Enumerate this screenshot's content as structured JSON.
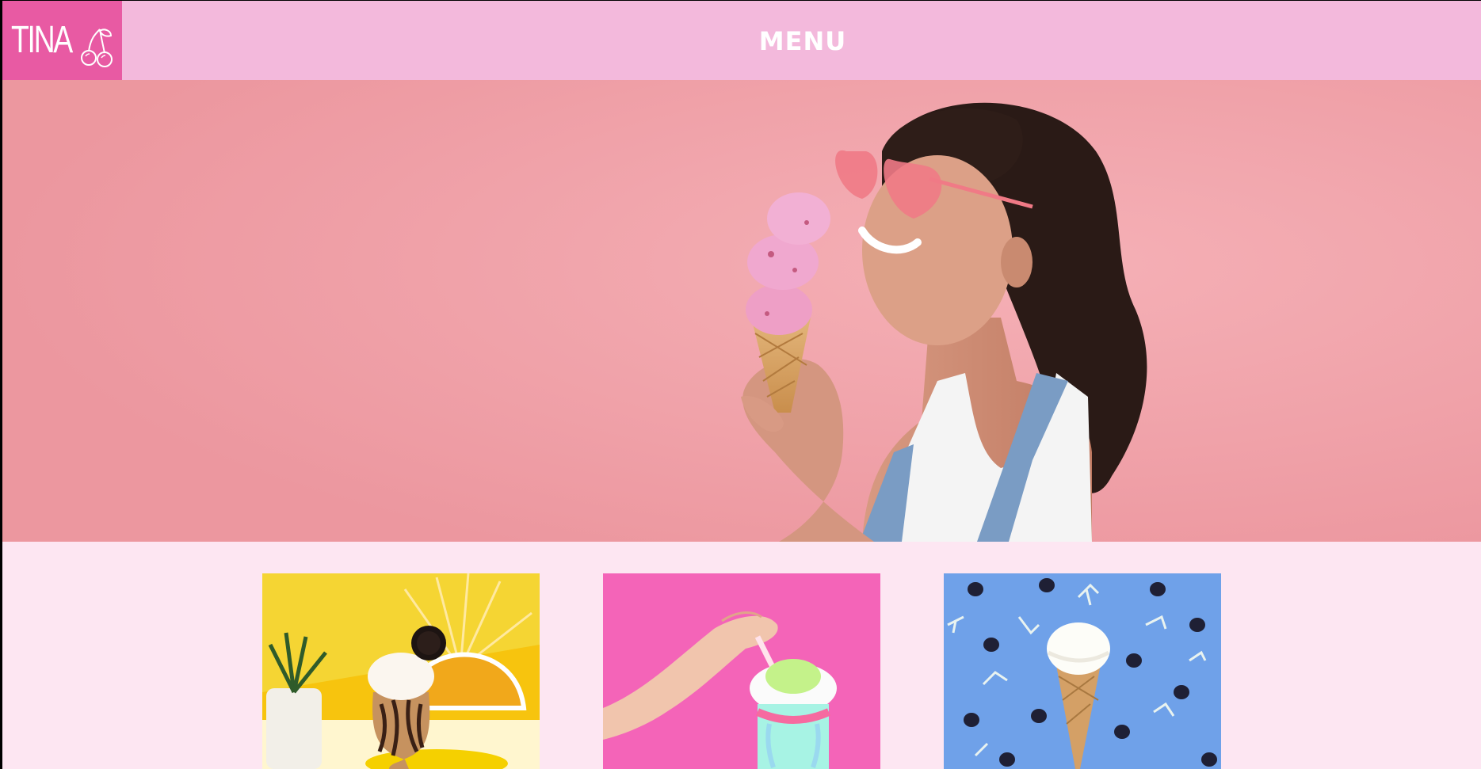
{
  "header": {
    "logo_text": "TINA",
    "logo_icon": "cherry-icon",
    "menu_label": "MENU"
  },
  "hero": {
    "image": "woman-with-ice-cream-cone"
  },
  "cards": [
    {
      "image": "oreo-milkshake"
    },
    {
      "image": "pink-freakshake"
    },
    {
      "image": "vanilla-cone-blackberries"
    }
  ],
  "colors": {
    "logo_bg": "#e85aa3",
    "header_bg": "#f3b9dc",
    "hero_bg": "#f0a3ab",
    "page_bg": "#fde6f2"
  }
}
